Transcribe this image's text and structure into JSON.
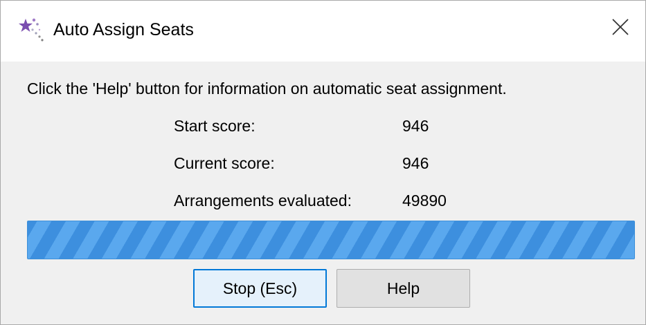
{
  "window": {
    "title": "Auto Assign Seats",
    "icon": "magic-wand-icon",
    "close_icon": "close-icon"
  },
  "content": {
    "info_text": "Click the 'Help' button for information on automatic seat assignment.",
    "stats": [
      {
        "label": "Start score:",
        "value": "946"
      },
      {
        "label": "Current score:",
        "value": "946"
      },
      {
        "label": "Arrangements evaluated:",
        "value": "49890"
      }
    ],
    "progress": {
      "mode": "indeterminate",
      "color": "#4a9be6"
    }
  },
  "buttons": {
    "stop_label": "Stop (Esc)",
    "help_label": "Help"
  },
  "colors": {
    "accent": "#0078d7",
    "background": "#f0f0f0"
  }
}
